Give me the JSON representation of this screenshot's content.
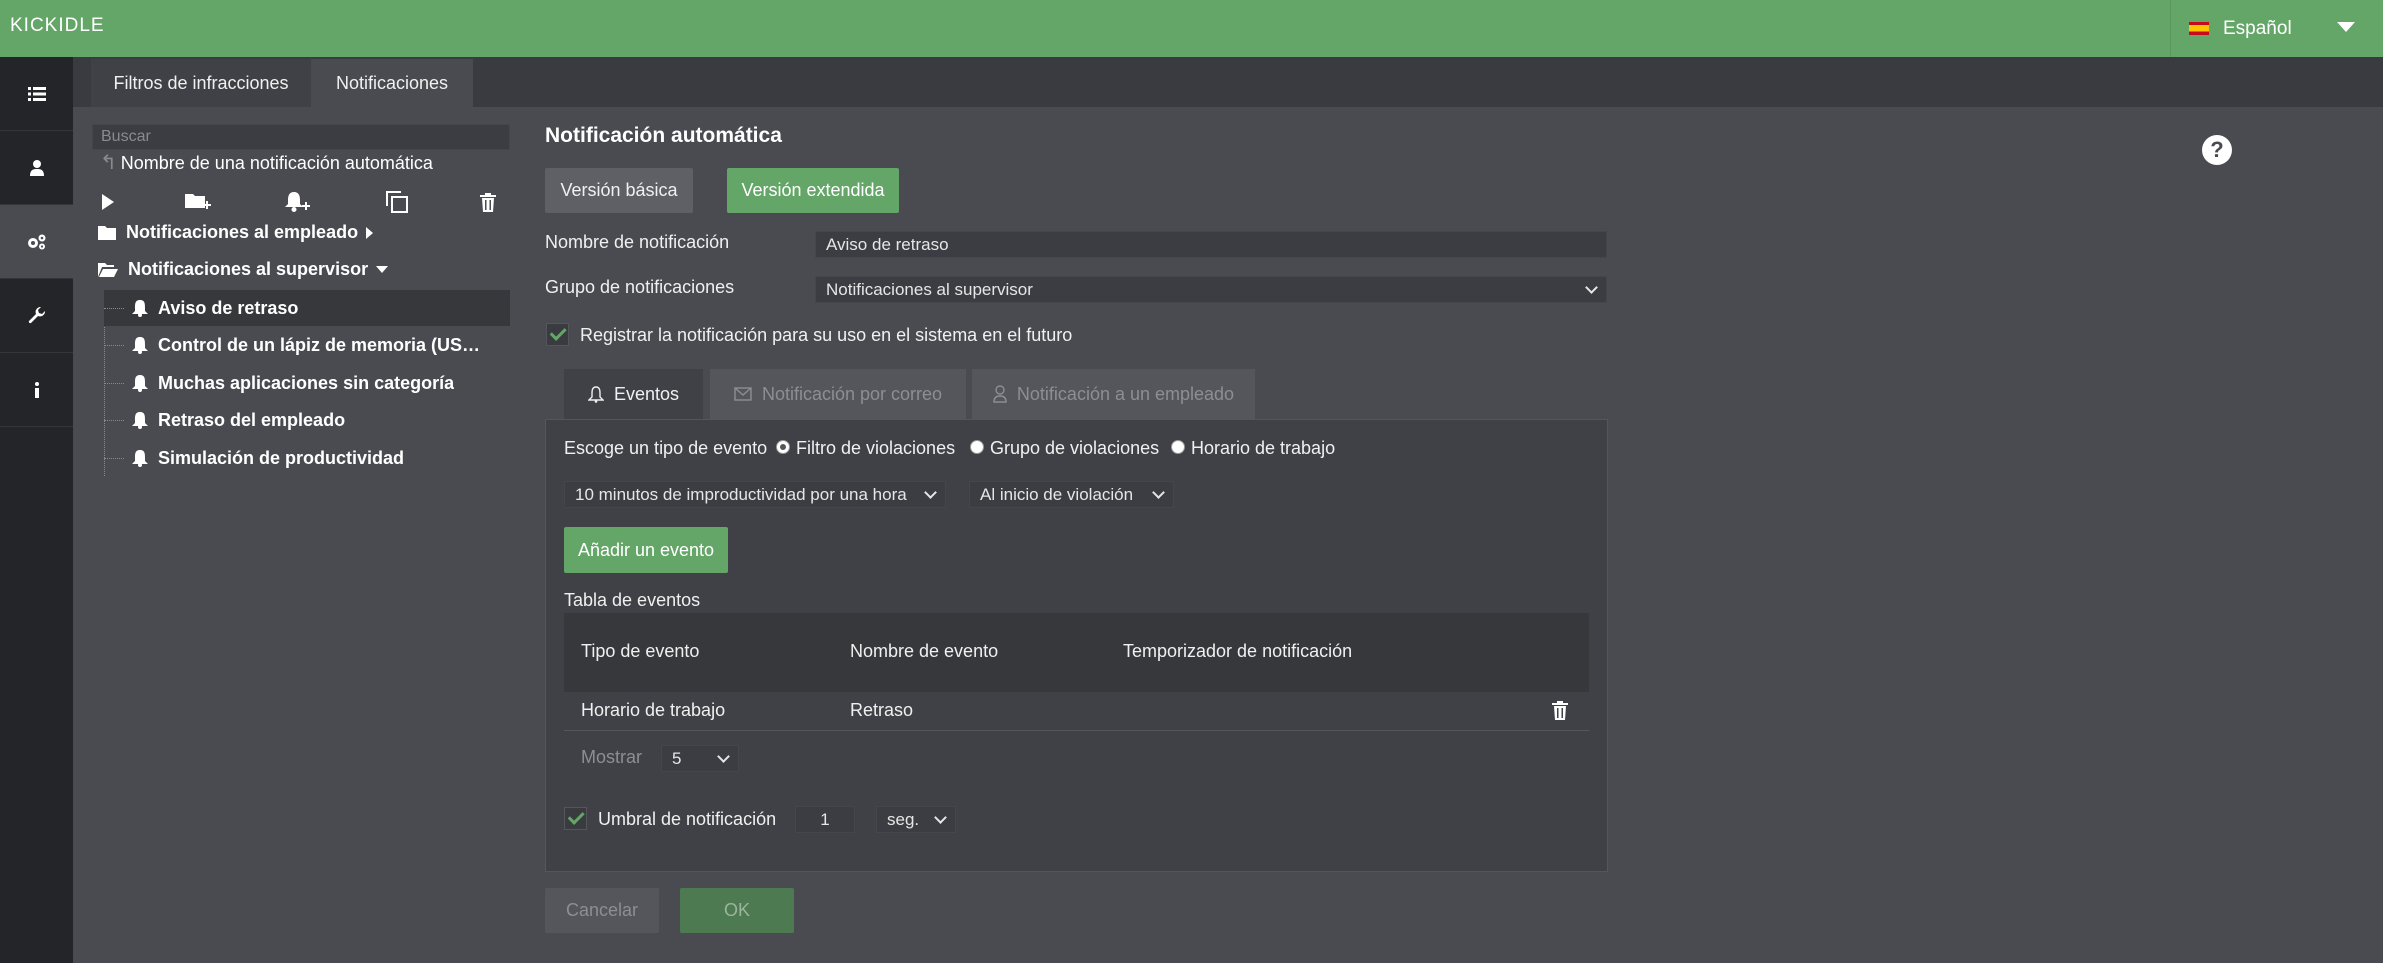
{
  "app": {
    "logo": "KICKIDLER",
    "language": "Español"
  },
  "nav": {
    "icons": [
      "list-icon",
      "user-icon",
      "settings-icon",
      "wrench-icon",
      "info-icon"
    ],
    "active_index": 2
  },
  "tabs": [
    {
      "label": "Filtros de infracciones",
      "active": false
    },
    {
      "label": "Notificaciones",
      "active": true
    }
  ],
  "sidebar": {
    "search_placeholder": "Buscar",
    "hint": "Nombre de una notificación automática",
    "tools": [
      "play-icon",
      "add-folder-icon",
      "add-notification-icon",
      "copy-icon",
      "trash-icon"
    ],
    "folders": [
      {
        "label": "Notificaciones al empleado",
        "expanded": false
      },
      {
        "label": "Notificaciones al supervisor",
        "expanded": true
      }
    ],
    "items": [
      {
        "label": "Aviso de retraso",
        "selected": true
      },
      {
        "label": "Control de un lápiz de memoria (USB drive)",
        "selected": false
      },
      {
        "label": "Muchas aplicaciones sin categoría",
        "selected": false
      },
      {
        "label": "Retraso del empleado",
        "selected": false
      },
      {
        "label": "Simulación de productividad",
        "selected": false
      }
    ]
  },
  "main": {
    "title": "Notificación automática",
    "version_basic": "Versión básica",
    "version_extended": "Versión extendida",
    "name_label": "Nombre de notificación",
    "name_value": "Aviso de retraso",
    "group_label": "Grupo de notificaciones",
    "group_value": "Notificaciones al supervisor",
    "register_label": "Registrar la notificación para su uso en el sistema en el futuro",
    "register_checked": true,
    "subtabs": [
      {
        "label": "Eventos",
        "icon": "bell-icon",
        "active": true
      },
      {
        "label": "Notificación por correo",
        "icon": "mail-icon",
        "active": false
      },
      {
        "label": "Notificación a un empleado",
        "icon": "user-icon",
        "active": false
      }
    ],
    "event_type_label": "Escoge un tipo de evento",
    "event_types": [
      {
        "label": "Filtro de violaciones",
        "selected": true
      },
      {
        "label": "Grupo de violaciones",
        "selected": false
      },
      {
        "label": "Horario de trabajo",
        "selected": false
      }
    ],
    "filter_value": "10 minutos de improductividad por una hora",
    "timing_value": "Al inicio de violación",
    "add_event": "Añadir un evento",
    "table_title": "Tabla de eventos",
    "columns": [
      "Tipo de evento",
      "Nombre de evento",
      "Temporizador de notificación"
    ],
    "rows": [
      {
        "type": "Horario de trabajo",
        "name": "Retraso",
        "timer": ""
      }
    ],
    "show_label": "Mostrar",
    "show_value": "5",
    "threshold_label": "Umbral de notificación",
    "threshold_checked": true,
    "threshold_value": "1",
    "threshold_unit": "seg.",
    "cancel": "Cancelar",
    "ok": "OK"
  },
  "colors": {
    "accent": "#64a667",
    "background": "#4a4b51",
    "nav": "#242528"
  }
}
